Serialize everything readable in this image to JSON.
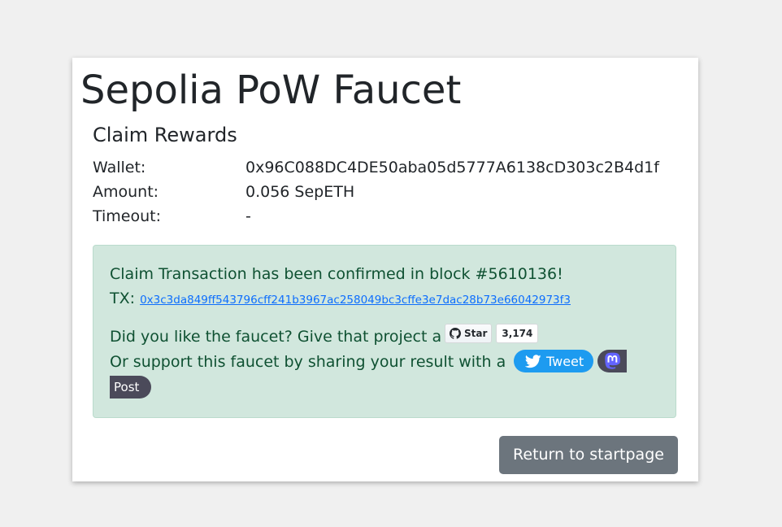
{
  "page": {
    "title": "Sepolia PoW Faucet",
    "section_title": "Claim Rewards"
  },
  "claim": {
    "wallet_label": "Wallet:",
    "wallet_value": "0x96C088DC4DE50aba05d5777A6138cD303c2B4d1f",
    "amount_label": "Amount:",
    "amount_value": "0.056 SepETH",
    "timeout_label": "Timeout:",
    "timeout_value": "-"
  },
  "alert": {
    "confirmed_text": "Claim Transaction has been confirmed in block #5610136!",
    "tx_label": "TX:",
    "tx_hash": "0x3c3da849ff543796cff241b3967ac258049bc3cffe3e7dac28b73e66042973f3",
    "like_text": "Did you like the faucet? Give that project a",
    "share_text": "Or support this faucet by sharing your result with a"
  },
  "github": {
    "star_label": "Star",
    "star_count": "3,174"
  },
  "share": {
    "tweet_label": "Tweet",
    "post_label": "Post"
  },
  "actions": {
    "return_label": "Return to startpage"
  },
  "colors": {
    "alert_bg": "#d1e7dd",
    "alert_text": "#0f5132",
    "link": "#0d6efd",
    "twitter": "#1d9bf0",
    "mastodon": "#4b4a5a",
    "secondary_button": "#6c757d"
  },
  "icons": {
    "github": "github-icon",
    "twitter": "twitter-bird-icon",
    "mastodon": "mastodon-icon"
  }
}
